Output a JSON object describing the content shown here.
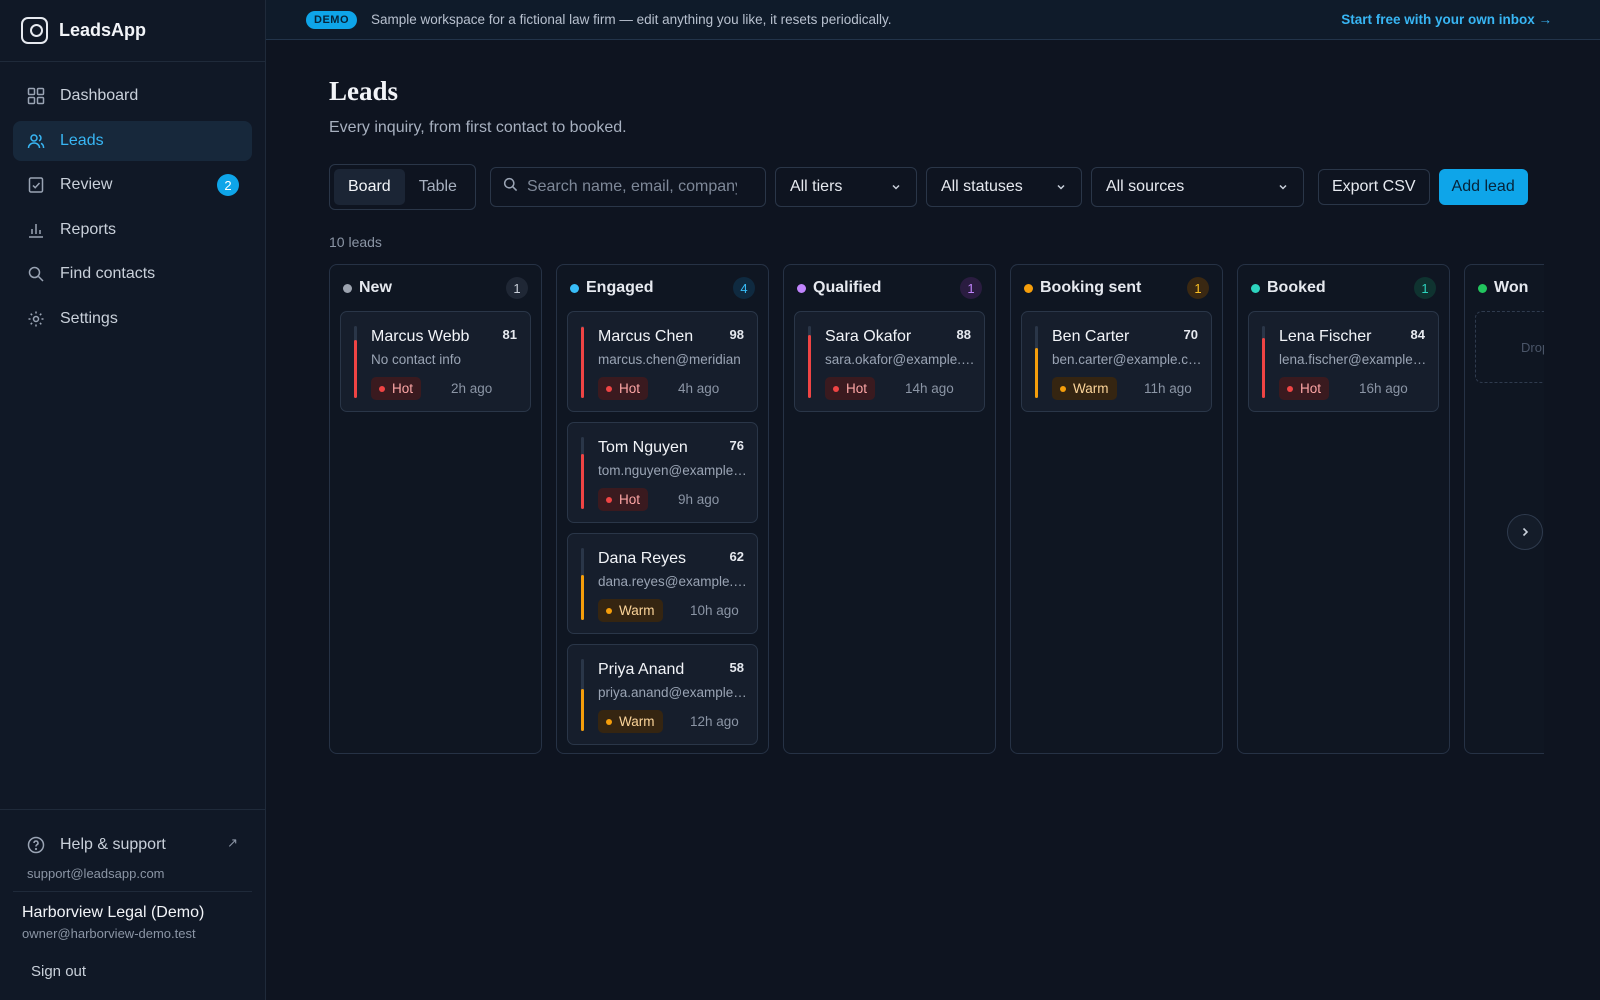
{
  "app": {
    "name": "LeadsApp"
  },
  "banner": {
    "pill": "DEMO",
    "text": "Sample workspace for a fictional law firm — edit anything you like, it resets periodically.",
    "link": "Start free with your own inbox →"
  },
  "sidebar": {
    "items": [
      {
        "label": "Dashboard",
        "icon": "grid-icon"
      },
      {
        "label": "Leads",
        "icon": "users-icon",
        "active": true
      },
      {
        "label": "Review",
        "icon": "check-square-icon",
        "badge": "2"
      },
      {
        "label": "Reports",
        "icon": "bar-chart-icon"
      },
      {
        "label": "Find contacts",
        "icon": "search-icon"
      },
      {
        "label": "Settings",
        "icon": "gear-icon"
      }
    ],
    "help": {
      "label": "Help & support",
      "email": "support@leadsapp.com"
    },
    "user": {
      "name": "Harborview Legal (Demo)",
      "email": "owner@harborview-demo.test"
    },
    "signout": "Sign out"
  },
  "page": {
    "title": "Leads",
    "subtitle": "Every inquiry, from first contact to booked.",
    "lead_count": "10 leads"
  },
  "toolbar": {
    "view_board": "Board",
    "view_table": "Table",
    "search_placeholder": "Search name, email, company",
    "filter_tiers": "All tiers",
    "filter_statuses": "All statuses",
    "filter_sources": "All sources",
    "export": "Export CSV",
    "add": "Add lead"
  },
  "colors": {
    "accent": "#0ea5e9",
    "hot": "#ef4444",
    "warm": "#f59e0b"
  },
  "columns": [
    {
      "title": "New",
      "count": "1",
      "dot": "#9ca3af",
      "count_bg": "#1f2735",
      "count_fg": "#c9d0da",
      "cards": [
        {
          "name": "Marcus Webb",
          "score": "81",
          "sub": "No contact info",
          "tier": "Hot",
          "tier_key": "hot",
          "time": "2h ago"
        }
      ]
    },
    {
      "title": "Engaged",
      "count": "4",
      "dot": "#38bdf8",
      "count_bg": "#0f2a40",
      "count_fg": "#38bdf8",
      "cards": [
        {
          "name": "Marcus Chen",
          "score": "98",
          "sub": "marcus.chen@meridian",
          "tier": "Hot",
          "tier_key": "hot",
          "time": "4h ago"
        },
        {
          "name": "Tom Nguyen",
          "score": "76",
          "sub": "tom.nguyen@example.com",
          "tier": "Hot",
          "tier_key": "hot",
          "time": "9h ago"
        },
        {
          "name": "Dana Reyes",
          "score": "62",
          "sub": "dana.reyes@example.com",
          "tier": "Warm",
          "tier_key": "warm",
          "time": "10h ago"
        },
        {
          "name": "Priya Anand",
          "score": "58",
          "sub": "priya.anand@example.com",
          "tier": "Warm",
          "tier_key": "warm",
          "time": "12h ago"
        }
      ]
    },
    {
      "title": "Qualified",
      "count": "1",
      "dot": "#c084fc",
      "count_bg": "#2a1c40",
      "count_fg": "#c084fc",
      "cards": [
        {
          "name": "Sara Okafor",
          "score": "88",
          "sub": "sara.okafor@example.com",
          "tier": "Hot",
          "tier_key": "hot",
          "time": "14h ago"
        }
      ]
    },
    {
      "title": "Booking sent",
      "count": "1",
      "dot": "#f59e0b",
      "count_bg": "#3a2812",
      "count_fg": "#fbbf24",
      "cards": [
        {
          "name": "Ben Carter",
          "score": "70",
          "sub": "ben.carter@example.com",
          "tier": "Warm",
          "tier_key": "warm",
          "time": "11h ago"
        }
      ]
    },
    {
      "title": "Booked",
      "count": "1",
      "dot": "#2dd4bf",
      "count_bg": "#0f3330",
      "count_fg": "#2dd4bf",
      "cards": [
        {
          "name": "Lena Fischer",
          "score": "84",
          "sub": "lena.fischer@example.com",
          "tier": "Hot",
          "tier_key": "hot",
          "time": "16h ago"
        }
      ]
    },
    {
      "title": "Won",
      "count": "",
      "dot": "#22c55e",
      "count_bg": "transparent",
      "count_fg": "#22c55e",
      "cards": [],
      "drop": "Drop here"
    }
  ]
}
